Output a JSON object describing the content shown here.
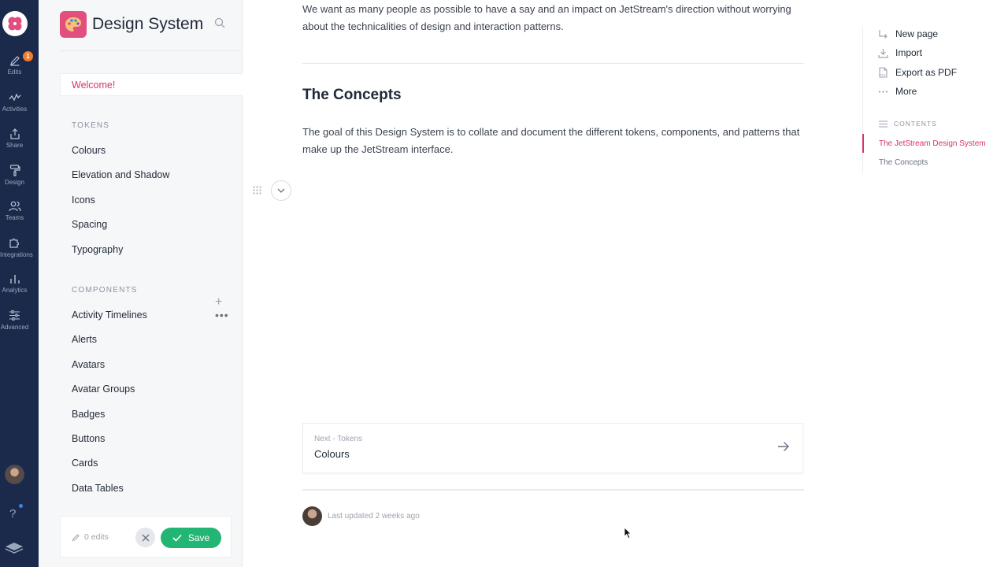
{
  "rail": {
    "badge_count": "1",
    "items": [
      {
        "label": "Edits",
        "icon": "pencil-icon"
      },
      {
        "label": "Activities",
        "icon": "activity-icon"
      },
      {
        "label": "Share",
        "icon": "share-icon"
      },
      {
        "label": "Design",
        "icon": "paint-roller-icon"
      },
      {
        "label": "Teams",
        "icon": "users-icon"
      },
      {
        "label": "Integrations",
        "icon": "puzzle-icon"
      },
      {
        "label": "Analytics",
        "icon": "bar-chart-icon"
      },
      {
        "label": "Advanced",
        "icon": "sliders-icon"
      }
    ],
    "help_label": "?"
  },
  "sidebar": {
    "title": "Design System",
    "welcome": "Welcome!",
    "tokens_title": "TOKENS",
    "tokens": [
      "Colours",
      "Elevation and Shadow",
      "Icons",
      "Spacing",
      "Typography"
    ],
    "components_title": "COMPONENTS",
    "components": [
      "Activity Timelines",
      "Alerts",
      "Avatars",
      "Avatar Groups",
      "Badges",
      "Buttons",
      "Cards",
      "Data Tables"
    ],
    "add_label": "+",
    "more_label": "•••",
    "edits_label": "0 edits",
    "save_label": "Save"
  },
  "main": {
    "intro": "We want as many people as possible to have a say and an impact on JetStream's direction without worrying about the technicalities of design and interaction patterns.",
    "heading": "The Concepts",
    "body": "The goal of this Design System is to collate and document the different tokens, components, and patterns that make up the JetStream interface.",
    "next_kicker": "Next - Tokens",
    "next_title": "Colours",
    "last_updated": "Last updated 2 weeks ago"
  },
  "right_panel": {
    "actions": [
      {
        "label": "New page",
        "icon": "new-page-icon"
      },
      {
        "label": "Import",
        "icon": "import-icon"
      },
      {
        "label": "Export as PDF",
        "icon": "pdf-icon"
      },
      {
        "label": "More",
        "icon": "more-icon"
      }
    ],
    "contents_title": "CONTENTS",
    "toc": [
      {
        "label": "The JetStream Design System",
        "active": true
      },
      {
        "label": "The Concepts",
        "active": false
      }
    ]
  },
  "colors": {
    "rail_bg": "#1b2a4a",
    "accent_pink": "#d6336c",
    "save_green": "#22b573",
    "badge_orange": "#ef7d2f"
  }
}
